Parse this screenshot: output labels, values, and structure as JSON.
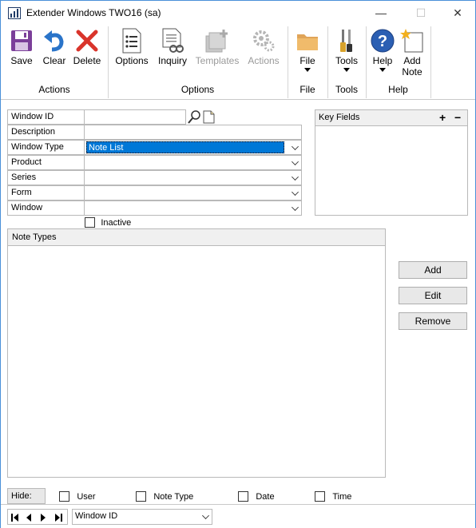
{
  "window": {
    "title": "Extender Windows   TWO16 (sa)",
    "minimize": "—",
    "maximize": "☐",
    "close": "✕"
  },
  "ribbon": {
    "save": "Save",
    "clear": "Clear",
    "delete": "Delete",
    "options": "Options",
    "inquiry": "Inquiry",
    "templates": "Templates",
    "actions_btn": "Actions",
    "file": "File",
    "tools": "Tools",
    "help": "Help",
    "add_note_line1": "Add",
    "add_note_line2": "Note",
    "groups": {
      "actions": "Actions",
      "options": "Options",
      "file": "File",
      "tools": "Tools",
      "help": "Help"
    }
  },
  "form": {
    "window_id_label": "Window ID",
    "window_id_value": "",
    "description_label": "Description",
    "description_value": "",
    "window_type_label": "Window Type",
    "window_type_value": "Note List",
    "product_label": "Product",
    "product_value": "",
    "series_label": "Series",
    "series_value": "",
    "form_label": "Form",
    "form_value": "",
    "window_label": "Window",
    "window_value": "",
    "inactive_label": "Inactive"
  },
  "key_fields": {
    "title": "Key Fields",
    "add_symbol": "+",
    "remove_symbol": "−"
  },
  "note_types": {
    "title": "Note Types"
  },
  "buttons": {
    "add": "Add",
    "edit": "Edit",
    "remove": "Remove"
  },
  "hide": {
    "label": "Hide:",
    "user": "User",
    "note_type": "Note Type",
    "date": "Date",
    "time": "Time"
  },
  "navigation": {
    "sort_by": "Window ID"
  }
}
